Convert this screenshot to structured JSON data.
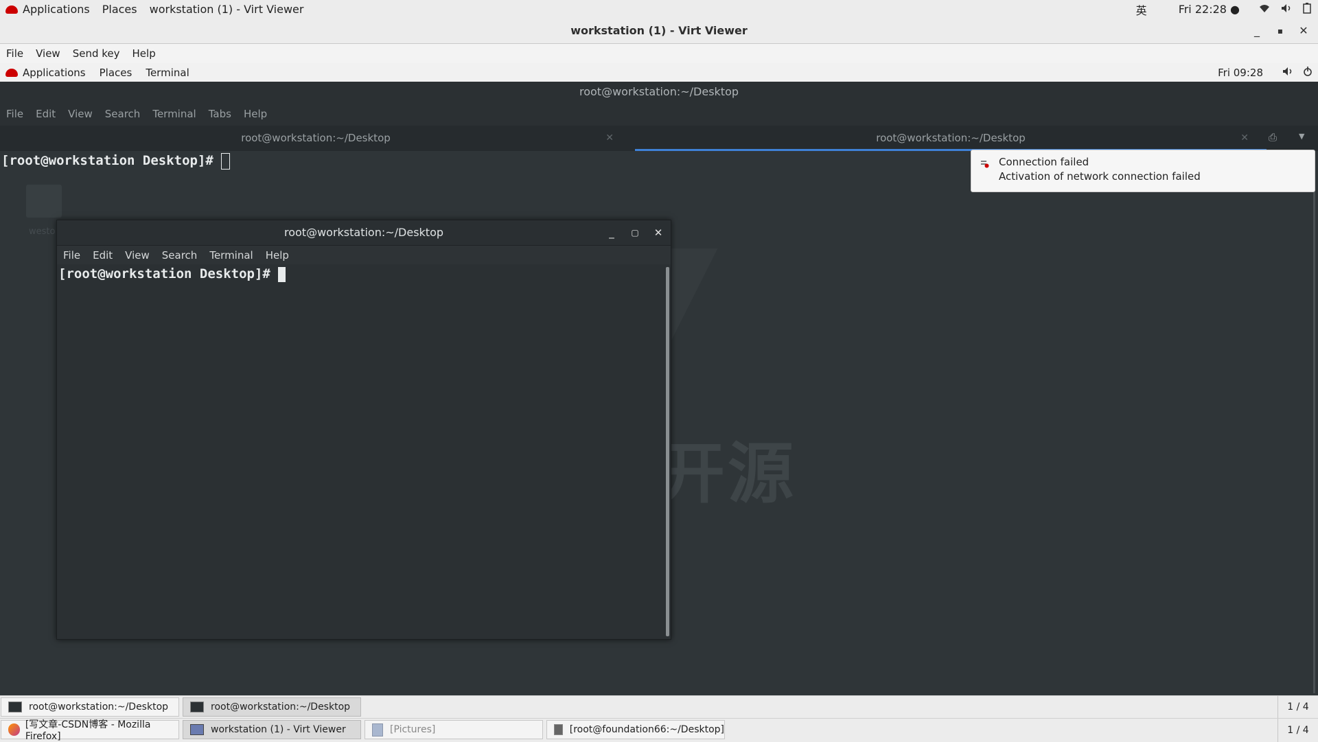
{
  "host": {
    "topbar": {
      "applications": "Applications",
      "places": "Places",
      "active_window": "workstation (1) - Virt Viewer",
      "input_method": "英",
      "clock": "Fri 22:28 ●"
    },
    "viewer": {
      "title": "workstation (1) - Virt Viewer",
      "menu": [
        "File",
        "View",
        "Send key",
        "Help"
      ]
    },
    "taskbar": {
      "items": [
        "[写文章-CSDN博客 - Mozilla Firefox]",
        "workstation (1) - Virt Viewer",
        "[Pictures]",
        "[root@foundation66:~/Desktop]"
      ],
      "pager": "1 / 4"
    }
  },
  "guest": {
    "topbar": {
      "applications": "Applications",
      "places": "Places",
      "terminal": "Terminal",
      "clock": "Fri 09:28"
    },
    "big_terminal": {
      "title": "root@workstation:~/Desktop",
      "menu": [
        "File",
        "Edit",
        "View",
        "Search",
        "Terminal",
        "Tabs",
        "Help"
      ],
      "tabs": [
        "root@workstation:~/Desktop",
        "root@workstation:~/Desktop"
      ],
      "prompt": "[root@workstation Desktop]# "
    },
    "desktop_icon_label": "westo",
    "watermark": "开源",
    "small_terminal": {
      "title": "root@workstation:~/Desktop",
      "menu": [
        "File",
        "Edit",
        "View",
        "Search",
        "Terminal",
        "Help"
      ],
      "prompt": "[root@workstation Desktop]# "
    },
    "notification": {
      "title": "Connection failed",
      "body": "Activation of network connection failed"
    },
    "taskbar": {
      "items": [
        "root@workstation:~/Desktop",
        "root@workstation:~/Desktop"
      ],
      "pager": "1 / 4"
    }
  },
  "colors": {
    "tab_accent": "#3e81d6",
    "redhat": "#cc0000"
  }
}
